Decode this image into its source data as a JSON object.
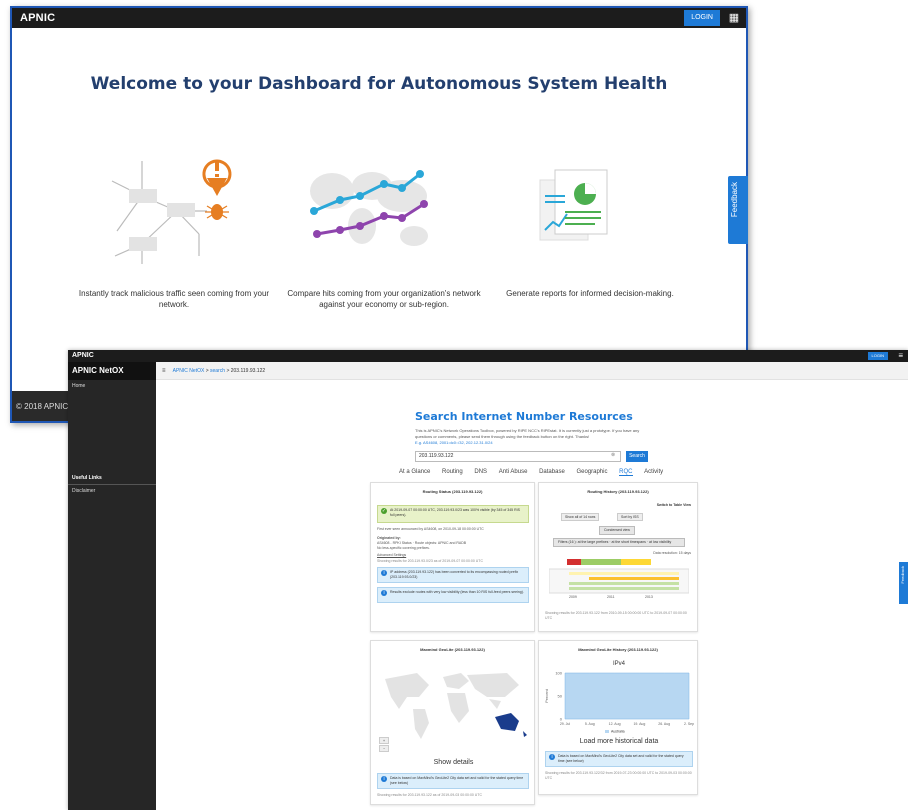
{
  "colors": {
    "accent": "#1e7ad6",
    "dark_bar": "#1c1c1c",
    "heading": "#233f6e"
  },
  "dashboard": {
    "logo": "APNIC",
    "login_label": "LOGIN",
    "apps_icon": "grid-icon",
    "welcome_title": "Welcome to your Dashboard for Autonomous System Health",
    "features": [
      {
        "icon": "malicious-traffic-icon",
        "caption": "Instantly track malicious traffic seen coming from your network."
      },
      {
        "icon": "compare-hits-chart-icon",
        "caption": "Compare hits coming from your organization's network against your economy or sub-region."
      },
      {
        "icon": "reports-icon",
        "caption": "Generate reports for informed decision-making."
      }
    ],
    "footer": "© 2018 APNIC",
    "feedback_label": "Feedback"
  },
  "netox": {
    "logo": "APNIC",
    "login_label": "LOGIN",
    "brand": "APNIC NetOX",
    "sidebar": {
      "home": "Home",
      "useful_links_heading": "Useful Links",
      "disclaimer": "Disclaimer"
    },
    "breadcrumb": {
      "root": "APNIC NetOX",
      "search": "search",
      "current": "203.119.93.122"
    },
    "page_title": "Search Internet Number Resources",
    "intro_text": "This is APNIC's Network Operations Toolbox, powered by RIPE NCC's RIPEstat. It is currently just a prototype. If you have any questions or comments, please send them through using the feedback button on the right. Thanks!",
    "intro_examples": "E.g. AS4608, 2001:dc0::/32, 202.12.31.0/24",
    "search_value": "203.119.93.122",
    "search_button": "Search",
    "tabs": [
      "At a Glance",
      "Routing",
      "DNS",
      "Anti Abuse",
      "Database",
      "Geographic",
      "RQC",
      "Activity"
    ],
    "active_tab": "RQC",
    "routing_status": {
      "title": "Routing Status (203.119.93.122)",
      "status_note": "At 2019-09-07 00:00:00 UTC, 203.119.93.0/23 was 100% visible (by 345 of 345 RIS full peers).",
      "first_seen": "First ever seen announced by AS4608, on 2010-09-18 00:00:00 UTC",
      "originated_by": "Originated by:",
      "origin_detail": "AS4608 - RPKI Status · Route objects: APNIC and RADB",
      "less_specific": "No less-specific covering prefixes.",
      "advanced": "Advanced Settings",
      "showing": "Showing results for 203.119.93.0/23 as of 2019-09-07 00:00:00 UTC",
      "note1": "IP address (203.119.93.122) has been converted to its encompassing routed prefix (203.119.93.0/23)",
      "note2": "Results exclude routes with very low visibility (less than 10 RIS full-feed peers seeing)."
    },
    "routing_history": {
      "title": "Routing History (203.119.93.122)",
      "switch_label": "Switch to Table View",
      "show_label": "Show",
      "show_value": "all",
      "of_label": "of",
      "rows_total": "14",
      "rows_label": "rows",
      "sort_label": "Sort by",
      "sort_value": "ISS",
      "condensed_label": "Condensed view",
      "filters_text": "Filters (16 ): at the large prefixes · at the short timespans · at low visibility",
      "data_resolution": "Data resolution: 15 days",
      "years": [
        "2009",
        "2011",
        "2013"
      ],
      "showing": "Showing results for 203.119.93.122 from 2010-09-15 00:00:00 UTC to 2019-09-07 00:00:00 UTC"
    },
    "geolite": {
      "title": "Maxmind GeoLite (203.119.93.122)",
      "show_details": "Show details",
      "note": "Data is based on MaxMind's GeoLite2 City data set and valid for the stated query time (see below)",
      "showing": "Showing results for 203.119.93.122 as of 2019-09-03 00:00:00 UTC"
    },
    "geolite_history": {
      "title": "Maxmind GeoLite History (203.119.93.122)",
      "chart_title": "IPv4",
      "load_more": "Load more historical data",
      "note": "Data is based on MaxMind's GeoLite2 City data set and valid for the stated query time (see below)",
      "showing": "Showing results for 203.119.93.122/32 from 2019-07-23 00:00:00 UTC to 2019-09-03 00:00:00 UTC"
    },
    "feedback_label": "Feedback"
  },
  "chart_data": {
    "type": "area",
    "title": "IPv4",
    "xlabel": "",
    "ylabel": "Percent",
    "x": [
      "29. Jul",
      "5. Aug",
      "12. Aug",
      "19. Aug",
      "26. Aug",
      "2. Sep"
    ],
    "ylim": [
      0,
      100
    ],
    "y_ticks": [
      "0",
      "50",
      "100"
    ],
    "series": [
      {
        "name": "Australia",
        "color": "#b7d7f2",
        "values": [
          100,
          100,
          100,
          100,
          100,
          100
        ]
      }
    ]
  }
}
